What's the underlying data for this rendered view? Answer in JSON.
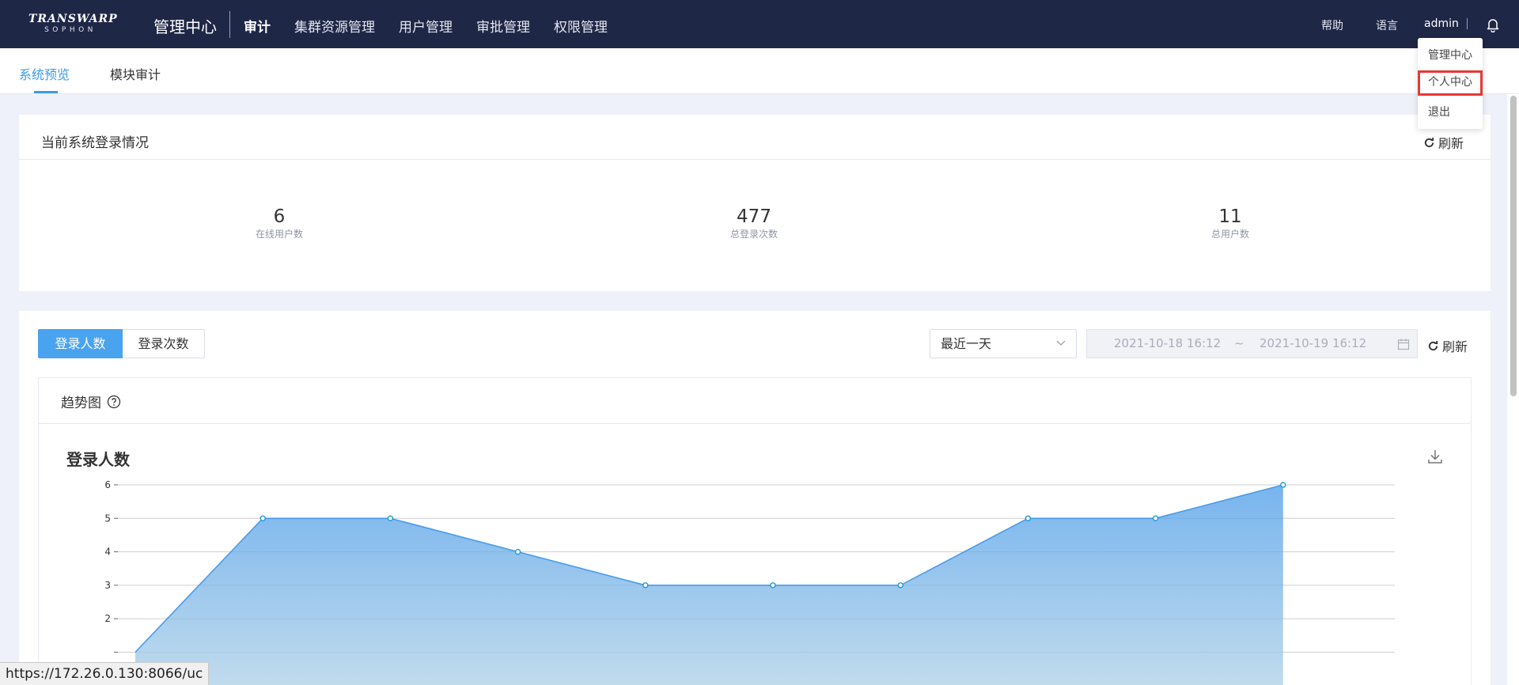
{
  "header": {
    "logo_top": "TRANSWARP",
    "logo_bottom": "SOPHON",
    "app_title": "管理中心",
    "nav": [
      "审计",
      "集群资源管理",
      "用户管理",
      "审批管理",
      "权限管理"
    ],
    "active_nav": "审计",
    "help": "帮助",
    "language": "语言",
    "user": "admin"
  },
  "user_menu": {
    "items": [
      "管理中心",
      "个人中心",
      "退出"
    ],
    "highlighted": "个人中心"
  },
  "subnav": {
    "tabs": [
      "系统预览",
      "模块审计"
    ],
    "active": "系统预览"
  },
  "login_status": {
    "title": "当前系统登录情况",
    "refresh": "刷新",
    "stats": [
      {
        "value": "6",
        "label": "在线用户数"
      },
      {
        "value": "477",
        "label": "总登录次数"
      },
      {
        "value": "11",
        "label": "总用户数"
      }
    ]
  },
  "trend_panel": {
    "segments": [
      "登录人数",
      "登录次数"
    ],
    "active_segment": "登录人数",
    "range_select": "最近一天",
    "date_start": "2021-10-18 16:12",
    "date_sep": "~",
    "date_end": "2021-10-19 16:12",
    "refresh": "刷新",
    "trend_title": "趋势图",
    "chart_heading": "登录人数"
  },
  "chart_data": {
    "type": "area",
    "title": "登录人数",
    "x": [
      0,
      1,
      2,
      3,
      4,
      5,
      6,
      7,
      8,
      9
    ],
    "values": [
      1,
      5,
      5,
      4,
      3,
      3,
      3,
      5,
      5,
      6
    ],
    "yticks": [
      2,
      3,
      4,
      5,
      6
    ],
    "ylim": [
      0,
      6
    ],
    "grid": true,
    "color": "#4a9be8"
  },
  "status_url": "https://172.26.0.130:8066/uc",
  "colors": {
    "topbar": "#1f2747",
    "accent": "#3d9be9",
    "highlight_border": "#e53935"
  }
}
